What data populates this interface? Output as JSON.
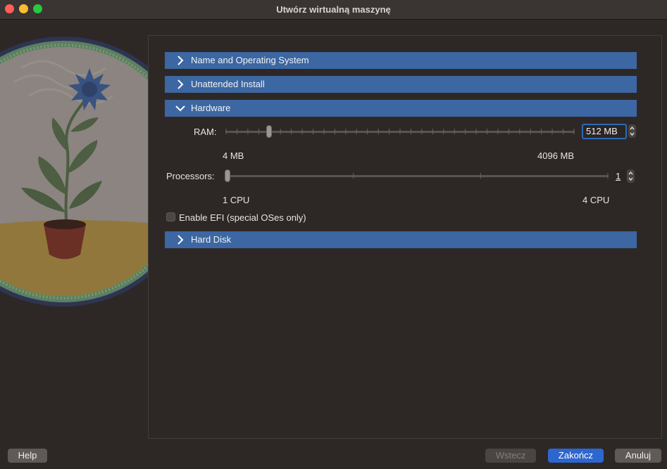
{
  "window": {
    "title": "Utwórz wirtualną maszynę"
  },
  "sections": {
    "name_os": "Name and Operating System",
    "unattended": "Unattended Install",
    "hardware": "Hardware",
    "hard_disk": "Hard Disk"
  },
  "hardware": {
    "ram_label": "RAM:",
    "ram_value": "512 MB",
    "ram_min": "4 MB",
    "ram_max": "4096 MB",
    "ram_fraction": 0.125,
    "proc_label": "Processors:",
    "proc_value": "1",
    "proc_min": "1 CPU",
    "proc_max": "4 CPU",
    "proc_fraction": 0,
    "efi_label": "Enable EFI (special OSes only)",
    "efi_checked": false
  },
  "buttons": {
    "help": "Help",
    "back": "Wstecz",
    "finish": "Zakończ",
    "cancel": "Anuluj"
  },
  "colors": {
    "section_header": "#3c67a2",
    "primary_button": "#2e66cf",
    "background": "#2d2826"
  }
}
